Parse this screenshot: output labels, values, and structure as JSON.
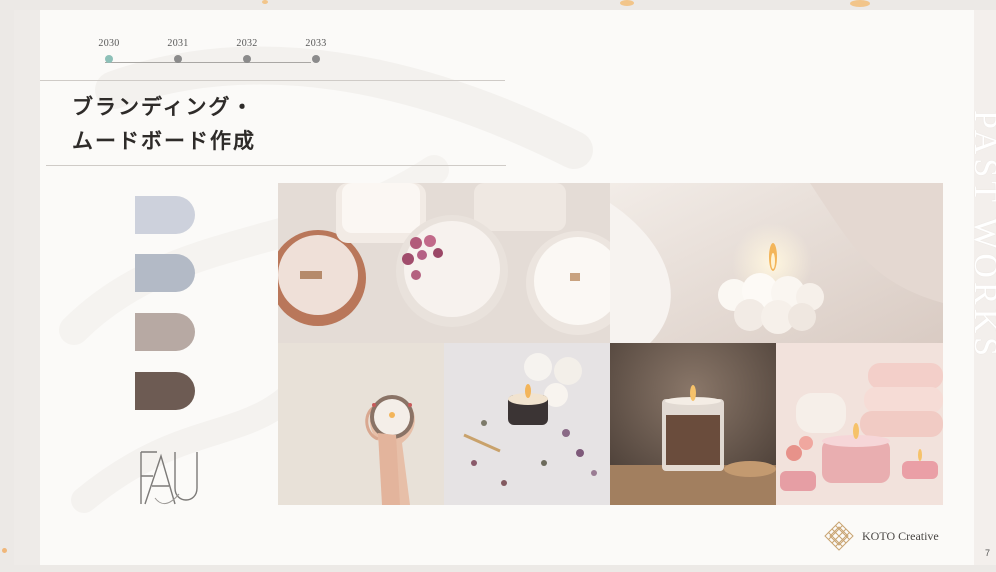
{
  "timeline": {
    "years": [
      "2030",
      "2031",
      "2032",
      "2033"
    ],
    "active_index": 0
  },
  "title": {
    "line1": "ブランディング・",
    "line2": "ムードボード作成"
  },
  "palette": [
    "#cdd1dc",
    "#b3bac6",
    "#b7a9a3",
    "#6d5b53"
  ],
  "logo_mark": "brand-monogram-icon",
  "photos": [
    {
      "subject": "candles-with-rosebuds"
    },
    {
      "subject": "bubble-candle-on-white-fabric"
    },
    {
      "subject": "hands-holding-candle"
    },
    {
      "subject": "candle-with-dried-herbs"
    },
    {
      "subject": "brown-candle-glass"
    },
    {
      "subject": "pink-candles-with-towels"
    }
  ],
  "brand": {
    "name": "KOTO Creative",
    "icon": "diamond-lattice-icon"
  },
  "side_label": "PAST WORKS",
  "page_number": "7",
  "colors": {
    "accent_dot": "#8dc0b8",
    "slide_bg": "#fbfaf8"
  }
}
